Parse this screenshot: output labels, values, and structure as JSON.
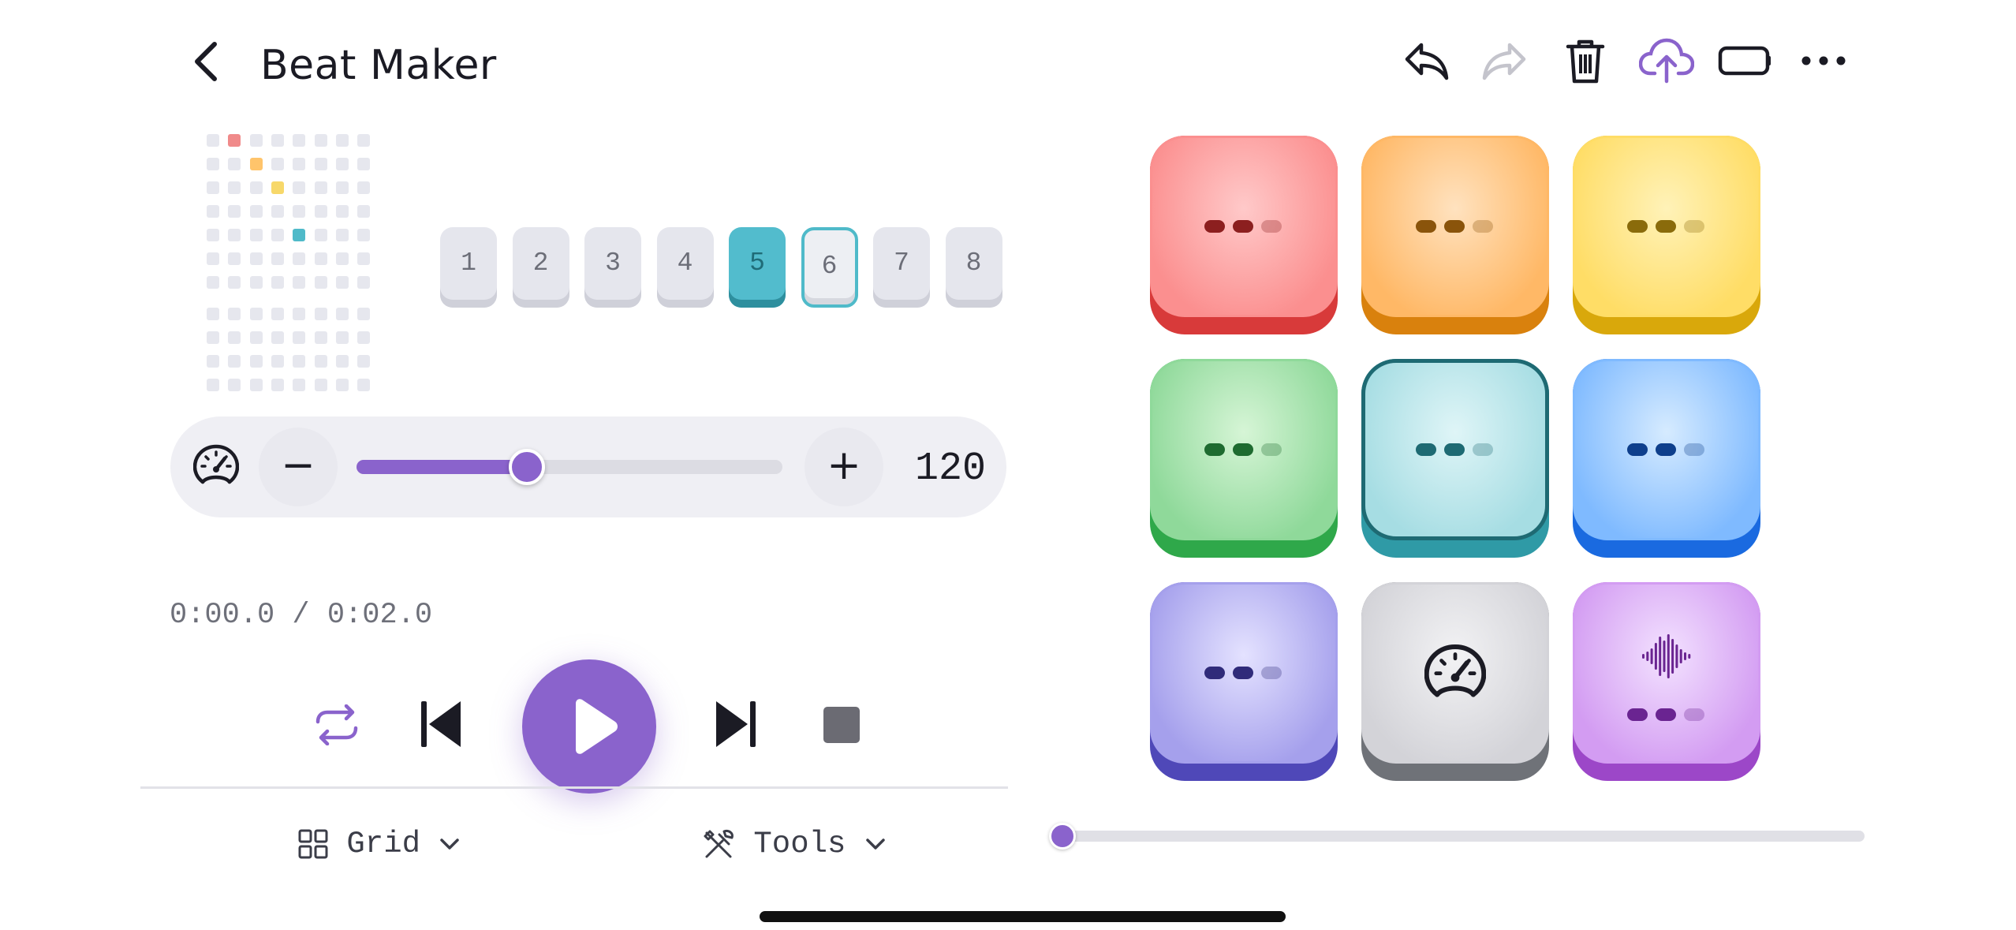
{
  "app": {
    "title": "Beat Maker"
  },
  "header_icons": [
    "chevron-left-icon",
    "undo-icon",
    "redo-icon",
    "trash-icon",
    "cloud-upload-icon",
    "battery-icon",
    "more-icon"
  ],
  "mini_grid": {
    "active": [
      {
        "row": 0,
        "col": 1,
        "color": "#f08a8a"
      },
      {
        "row": 1,
        "col": 2,
        "color": "#ffc46b"
      },
      {
        "row": 2,
        "col": 3,
        "color": "#f7d86a"
      },
      {
        "row": 4,
        "col": 4,
        "color": "#4fbac9"
      }
    ]
  },
  "patterns": {
    "labels": [
      "1",
      "2",
      "3",
      "4",
      "5",
      "6",
      "7",
      "8"
    ],
    "active_index": 4,
    "selected_index": 5
  },
  "tempo": {
    "value": "120",
    "slider_fraction": 0.4,
    "minus_label": "−",
    "plus_label": "+"
  },
  "time": {
    "display": "0:00.0 / 0:02.0"
  },
  "menus": {
    "grid_label": "Grid",
    "tools_label": "Tools"
  },
  "pads": [
    {
      "name": "pad-red",
      "top": "#ffc9c9",
      "mid": "#fb8f8f",
      "edge": "#d83a3a",
      "dot": "#8c1f1f",
      "icon": "dots"
    },
    {
      "name": "pad-orange",
      "top": "#ffe2bf",
      "mid": "#ffb866",
      "edge": "#d9810d",
      "dot": "#8a540b",
      "icon": "dots"
    },
    {
      "name": "pad-yellow",
      "top": "#fff2b8",
      "mid": "#ffdd66",
      "edge": "#d9a80b",
      "dot": "#8a6b0b",
      "icon": "dots"
    },
    {
      "name": "pad-green",
      "top": "#d6f5d6",
      "mid": "#8fd99a",
      "edge": "#2fa84a",
      "dot": "#1e6b30",
      "icon": "dots"
    },
    {
      "name": "pad-teal",
      "top": "#dff5f7",
      "mid": "#a6dde3",
      "edge": "#2f9aa6",
      "dot": "#1e6a73",
      "icon": "dots",
      "selected": true
    },
    {
      "name": "pad-blue",
      "top": "#d6ebff",
      "mid": "#7fbaff",
      "edge": "#1a6ae0",
      "dot": "#0e3f8c",
      "icon": "dots"
    },
    {
      "name": "pad-indigo",
      "top": "#e4e2ff",
      "mid": "#a5a0ec",
      "edge": "#4f48b8",
      "dot": "#302b7a",
      "icon": "dots"
    },
    {
      "name": "pad-gray",
      "top": "#f2f2f4",
      "mid": "#d3d3d8",
      "edge": "#6f7278",
      "dot": "#1b1b24",
      "icon": "gauge-icon"
    },
    {
      "name": "pad-purple",
      "top": "#f3e2ff",
      "mid": "#d39cf2",
      "edge": "#9c47c8",
      "dot": "#6a2491",
      "icon": "waveform-icon"
    }
  ],
  "seek": {
    "fraction": 0.0
  }
}
